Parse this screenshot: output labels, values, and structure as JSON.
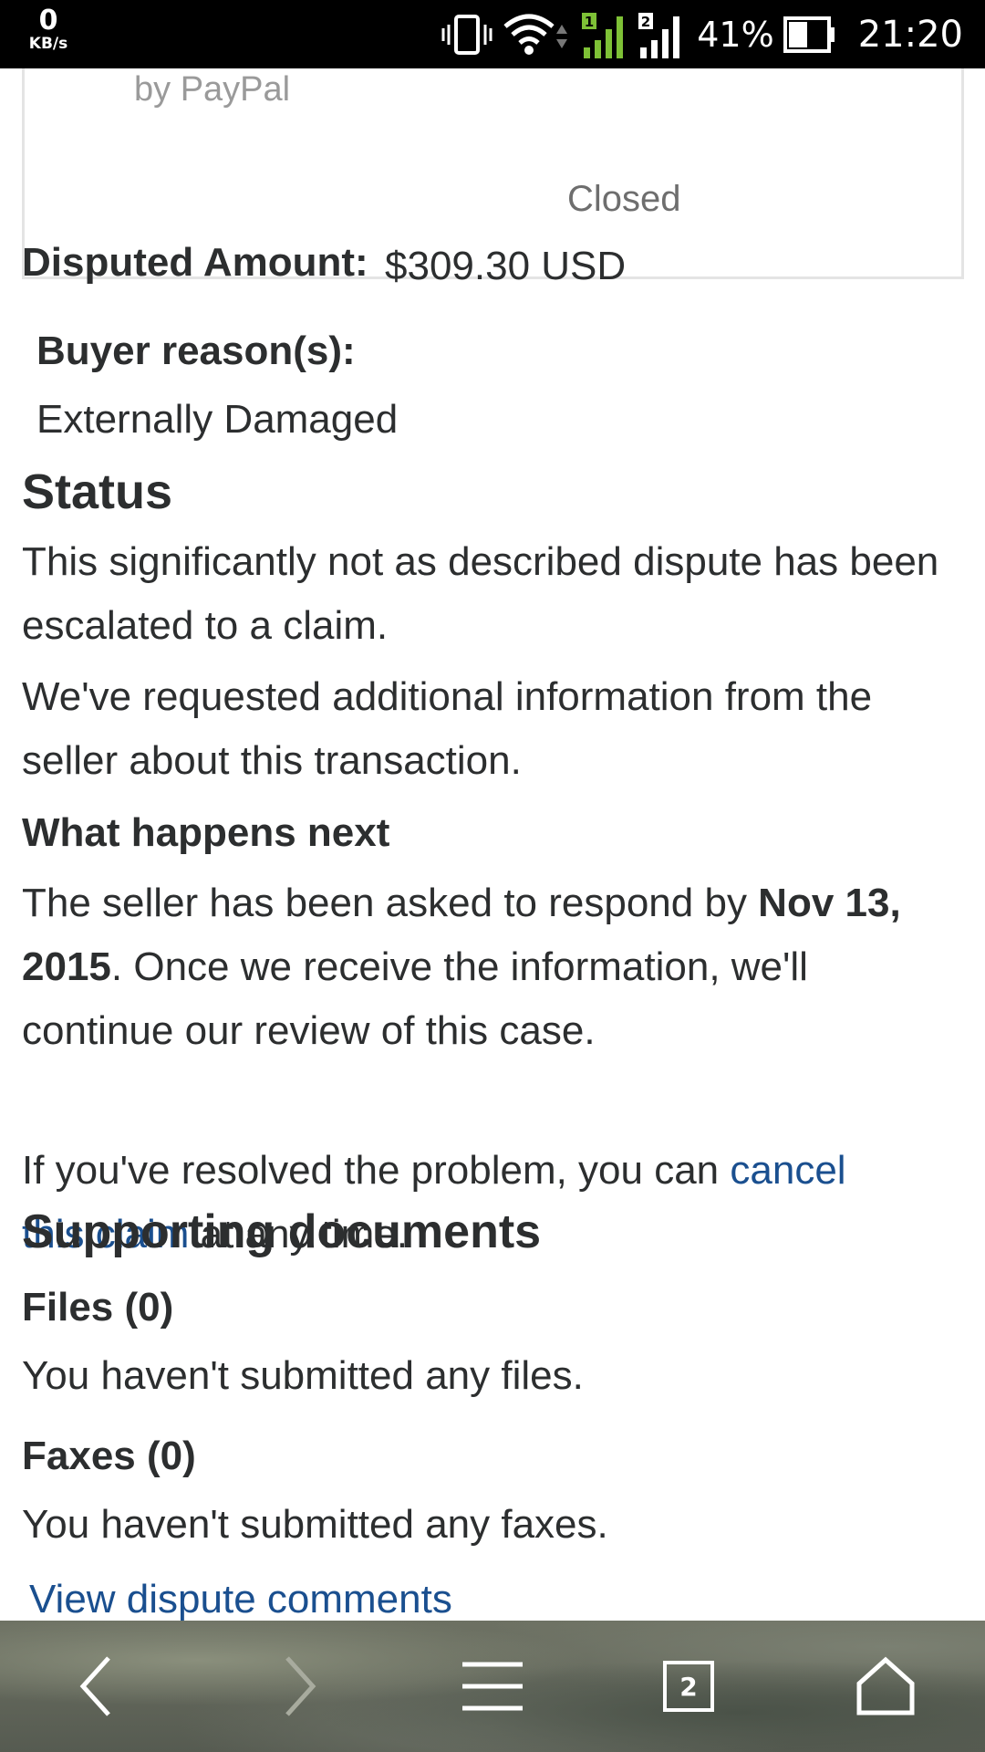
{
  "status_bar": {
    "net_speed_value": "0",
    "net_speed_unit": "KB/s",
    "sim1_label": "1",
    "sim2_label": "2",
    "battery_percent": "41%",
    "time": "21:20",
    "icons": [
      "vibrate-icon",
      "wifi-icon",
      "signal-sim1-icon",
      "signal-sim2-icon",
      "battery-icon"
    ]
  },
  "case_box": {
    "cut_text": "by PayPal",
    "status": "Closed"
  },
  "dispute": {
    "amount_label": "Disputed Amount:",
    "amount_value": "$309.30 USD",
    "buyer_reasons_label": "Buyer reason(s):",
    "buyer_reason": "Externally Damaged"
  },
  "status_section": {
    "heading": "Status",
    "para1": "This significantly not as described dispute has been escalated to a claim.",
    "para2": "We've requested additional information from the seller about this transaction."
  },
  "next_section": {
    "heading": "What happens next",
    "line1_prefix": "The seller has been asked to respond by ",
    "line1_date_a": "Nov 13,",
    "line2_date_b": "2015",
    "line2_suffix": ". Once we receive the information, we'll",
    "line3": "continue our review of this case.",
    "resolve_prefix": "If you've resolved the problem, you can ",
    "cancel_link_a": "cancel",
    "cancel_link_b": "this claim",
    "resolve_suffix": " at any time."
  },
  "documents": {
    "heading": "Supporting documents",
    "files_label": "Files (0)",
    "files_text": "You haven't submitted any files.",
    "faxes_label": "Faxes (0)",
    "faxes_text": "You haven't submitted any faxes.",
    "comments_link": "View dispute comments"
  },
  "nav_bar": {
    "tab_count": "2",
    "icons": [
      "back-icon",
      "forward-icon",
      "menu-icon",
      "tabs-icon",
      "home-icon"
    ]
  }
}
